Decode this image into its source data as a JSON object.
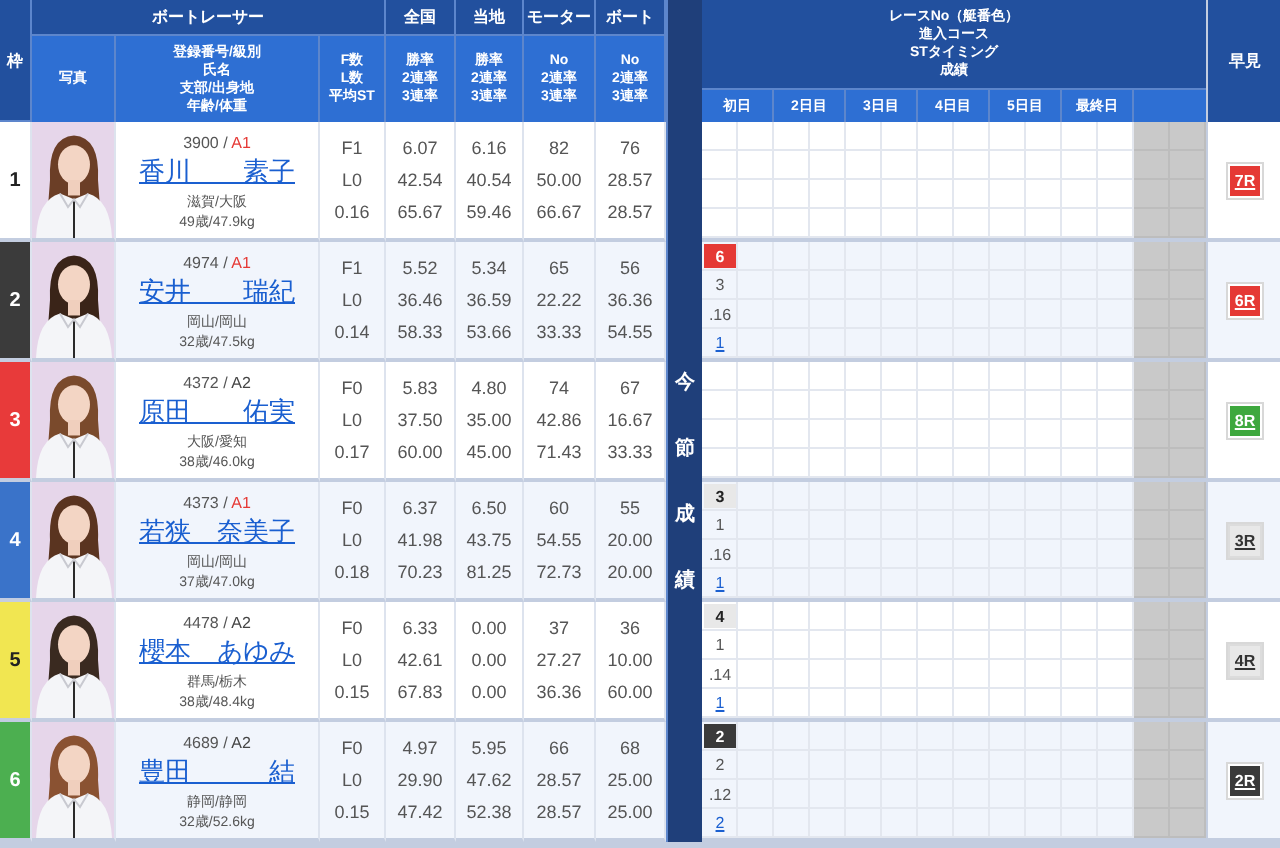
{
  "left_header": {
    "lane": "枠",
    "racer": "ボートレーサー",
    "groups": [
      "全国",
      "当地",
      "モーター",
      "ボート"
    ],
    "photo": "写真",
    "info": [
      "登録番号/級別",
      "氏名",
      "支部/出身地",
      "年齢/体重"
    ],
    "start": [
      "F数",
      "L数",
      "平均ST"
    ],
    "stats": [
      [
        "勝率",
        "2連率",
        "3連率"
      ],
      [
        "勝率",
        "2連率",
        "3連率"
      ],
      [
        "No",
        "2連率",
        "3連率"
      ],
      [
        "No",
        "2連率",
        "3連率"
      ]
    ]
  },
  "series_band": "今節成績",
  "right_header": {
    "title": [
      "レースNo（艇番色）",
      "進入コース",
      "STタイミング",
      "成績"
    ],
    "days": [
      "初日",
      "2日目",
      "3日目",
      "4日目",
      "5日目",
      "最終日"
    ],
    "quick": "早見"
  },
  "racers": [
    {
      "lane": {
        "number": "1",
        "color": "#ffffff"
      },
      "number": "3900 / ",
      "grade": {
        "label": "A1",
        "color": "#e53935"
      },
      "name": "香川　　素子",
      "branch": "滋賀/大阪",
      "age_weight": "49歳/47.9kg",
      "start": [
        "F1",
        "L0",
        "0.16"
      ],
      "stats": [
        [
          "6.07",
          "42.54",
          "65.67"
        ],
        [
          "6.16",
          "40.54",
          "59.46"
        ],
        [
          "82",
          "50.00",
          "66.67"
        ],
        [
          "76",
          "28.57",
          "28.57"
        ]
      ],
      "quick": {
        "label": "7R",
        "color": "#e53935"
      }
    },
    {
      "lane": {
        "number": "2",
        "color": "#3b3b3b"
      },
      "number": "4974 / ",
      "grade": {
        "label": "A1",
        "color": "#e53935"
      },
      "name": "安井　　瑞紀",
      "branch": "岡山/岡山",
      "age_weight": "32歳/47.5kg",
      "start": [
        "F1",
        "L0",
        "0.14"
      ],
      "stats": [
        [
          "5.52",
          "36.46",
          "58.33"
        ],
        [
          "5.34",
          "36.59",
          "53.66"
        ],
        [
          "65",
          "22.22",
          "33.33"
        ],
        [
          "56",
          "36.36",
          "54.55"
        ]
      ],
      "results": [
        {
          "race": "6",
          "color": "#e53935",
          "course": "3",
          "st": ".16",
          "finish": "1"
        }
      ],
      "quick": {
        "label": "6R",
        "color": "#e53935"
      }
    },
    {
      "lane": {
        "number": "3",
        "color": "#e83a3a"
      },
      "number": "4372 / ",
      "grade": {
        "label": "A2",
        "color": "#444444"
      },
      "name": "原田　　佑実",
      "branch": "大阪/愛知",
      "age_weight": "38歳/46.0kg",
      "start": [
        "F0",
        "L0",
        "0.17"
      ],
      "stats": [
        [
          "5.83",
          "37.50",
          "60.00"
        ],
        [
          "4.80",
          "35.00",
          "45.00"
        ],
        [
          "74",
          "42.86",
          "71.43"
        ],
        [
          "67",
          "16.67",
          "33.33"
        ]
      ],
      "quick": {
        "label": "8R",
        "color": "#3ea83e"
      }
    },
    {
      "lane": {
        "number": "4",
        "color": "#3a73c9"
      },
      "number": "4373 / ",
      "grade": {
        "label": "A1",
        "color": "#e53935"
      },
      "name": "若狭　奈美子",
      "branch": "岡山/岡山",
      "age_weight": "37歳/47.0kg",
      "start": [
        "F0",
        "L0",
        "0.18"
      ],
      "stats": [
        [
          "6.37",
          "41.98",
          "70.23"
        ],
        [
          "6.50",
          "43.75",
          "81.25"
        ],
        [
          "60",
          "54.55",
          "72.73"
        ],
        [
          "55",
          "20.00",
          "20.00"
        ]
      ],
      "results": [
        {
          "race": "3",
          "color": "#e8e8e8",
          "course": "1",
          "st": ".16",
          "finish": "1"
        }
      ],
      "quick": {
        "label": "3R",
        "color": "#e8e8e8"
      }
    },
    {
      "lane": {
        "number": "5",
        "color": "#f1e651"
      },
      "number": "4478 / ",
      "grade": {
        "label": "A2",
        "color": "#444444"
      },
      "name": "櫻本　あゆみ",
      "branch": "群馬/栃木",
      "age_weight": "38歳/48.4kg",
      "start": [
        "F0",
        "L0",
        "0.15"
      ],
      "stats": [
        [
          "6.33",
          "42.61",
          "67.83"
        ],
        [
          "0.00",
          "0.00",
          "0.00"
        ],
        [
          "37",
          "27.27",
          "36.36"
        ],
        [
          "36",
          "10.00",
          "60.00"
        ]
      ],
      "results": [
        {
          "race": "4",
          "color": "#e8e8e8",
          "course": "1",
          "st": ".14",
          "finish": "1"
        }
      ],
      "quick": {
        "label": "4R",
        "color": "#e8e8e8"
      }
    },
    {
      "lane": {
        "number": "6",
        "color": "#4caf50"
      },
      "number": "4689 / ",
      "grade": {
        "label": "A2",
        "color": "#444444"
      },
      "name": "豊田　　　結",
      "branch": "静岡/静岡",
      "age_weight": "32歳/52.6kg",
      "start": [
        "F0",
        "L0",
        "0.15"
      ],
      "stats": [
        [
          "4.97",
          "29.90",
          "47.42"
        ],
        [
          "5.95",
          "47.62",
          "52.38"
        ],
        [
          "66",
          "28.57",
          "28.57"
        ],
        [
          "68",
          "25.00",
          "25.00"
        ]
      ],
      "results": [
        {
          "race": "2",
          "color": "#3a3a3a",
          "course": "2",
          "st": ".12",
          "finish": "2"
        }
      ],
      "quick": {
        "label": "2R",
        "color": "#3a3a3a"
      }
    }
  ]
}
